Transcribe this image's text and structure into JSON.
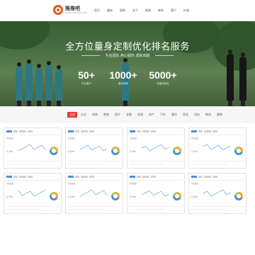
{
  "header": {
    "brand_name": "推推吧",
    "brand_sub": "WWW.TUITUIBA.COM",
    "nav": [
      "首页",
      "服务",
      "案例",
      "关于",
      "新闻",
      "联系",
      "客户",
      "价格"
    ]
  },
  "hero": {
    "title": "全方位量身定制优化排名服务",
    "subtitle": "专业团队 用心服务 成就卓越",
    "stats": [
      {
        "number": "50+",
        "label": "行业客户"
      },
      {
        "number": "1000+",
        "label": "服务案例"
      },
      {
        "number": "5000+",
        "label": "关键词排名"
      }
    ],
    "slides": 5,
    "active_slide": 2
  },
  "tabs": {
    "items": [
      "全部",
      "企业",
      "电商",
      "教育",
      "医疗",
      "金融",
      "旅游",
      "房产",
      "汽车",
      "餐饮",
      "家居",
      "科技",
      "物流",
      "服装"
    ],
    "active": 0
  },
  "cards": [
    {
      "title": "优化数据",
      "metric": "1.2%"
    },
    {
      "title": "优化数据",
      "metric": "3.5%"
    },
    {
      "title": "优化数据",
      "metric": "2.8%"
    },
    {
      "title": "优化数据",
      "metric": "4.1%"
    },
    {
      "title": "优化数据",
      "metric": "1.9%"
    },
    {
      "title": "优化数据",
      "metric": "2.2%"
    },
    {
      "title": "优化数据",
      "metric": "3.0%"
    },
    {
      "title": "优化数据",
      "metric": "5.6%"
    }
  ],
  "colors": {
    "accent": "#e8342a",
    "brand": "#e8571e",
    "chart_blue": "#4a90d9"
  }
}
